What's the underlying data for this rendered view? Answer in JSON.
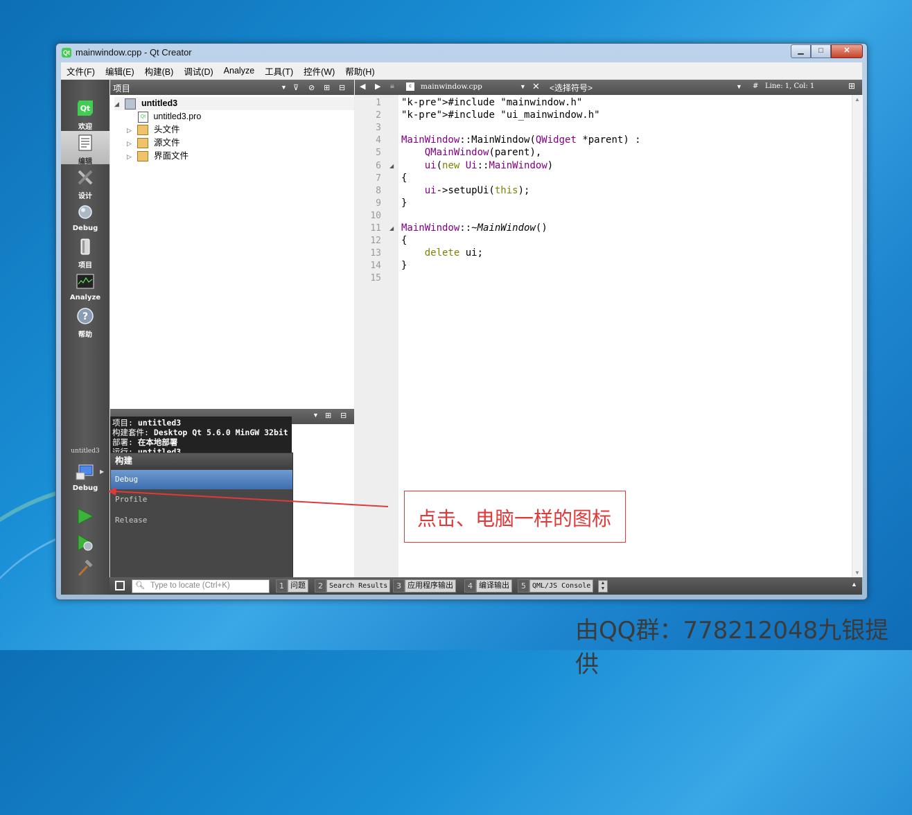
{
  "window": {
    "title": "mainwindow.cpp - Qt Creator",
    "controls": {
      "minimize": "▁",
      "maximize": "□",
      "close": "✕"
    }
  },
  "menu": [
    "文件(F)",
    "编辑(E)",
    "构建(B)",
    "调试(D)",
    "Analyze",
    "工具(T)",
    "控件(W)",
    "帮助(H)"
  ],
  "modes": [
    {
      "label": "欢迎",
      "icon": "qt-logo-icon"
    },
    {
      "label": "编辑",
      "icon": "document-icon",
      "active": true
    },
    {
      "label": "设计",
      "icon": "design-tools-icon"
    },
    {
      "label": "Debug",
      "icon": "bug-icon"
    },
    {
      "label": "项目",
      "icon": "project-icon"
    },
    {
      "label": "Analyze",
      "icon": "analyze-icon"
    },
    {
      "label": "帮助",
      "icon": "help-icon"
    }
  ],
  "kit_selector": {
    "project": "untitled3",
    "build": "Debug"
  },
  "project_panel": {
    "header": "项目",
    "tree": [
      {
        "label": "untitled3",
        "bold": true
      },
      {
        "label": "untitled3.pro"
      },
      {
        "label": "头文件"
      },
      {
        "label": "源文件"
      },
      {
        "label": "界面文件"
      }
    ]
  },
  "lower_panel": {
    "info": [
      {
        "key": "项目:",
        "value": "untitled3"
      },
      {
        "key": "构建套件:",
        "value": "Desktop Qt 5.6.0 MinGW 32bit"
      },
      {
        "key": "部署:",
        "value": "在本地部署"
      },
      {
        "key": "运行:",
        "value": "untitled3"
      }
    ]
  },
  "build_popup": {
    "header": "构建",
    "options": [
      "Debug",
      "Profile",
      "Release"
    ],
    "selected": "Debug"
  },
  "editor": {
    "file": "mainwindow.cpp",
    "symbol": "<选择符号>",
    "position": "Line: 1, Col: 1",
    "hash": "#"
  },
  "code_lines": [
    "#include \"mainwindow.h\"",
    "#include \"ui_mainwindow.h\"",
    "",
    "MainWindow::MainWindow(QWidget *parent) :",
    "    QMainWindow(parent),",
    "    ui(new Ui::MainWindow)",
    "{",
    "    ui->setupUi(this);",
    "}",
    "",
    "MainWindow::~MainWindow()",
    "{",
    "    delete ui;",
    "}",
    ""
  ],
  "status_bar": {
    "locator_placeholder": "Type to locate (Ctrl+K)",
    "tabs": [
      {
        "num": "1",
        "label": "问题"
      },
      {
        "num": "2",
        "label": "Search Results"
      },
      {
        "num": "3",
        "label": "应用程序输出"
      },
      {
        "num": "4",
        "label": "编译输出"
      },
      {
        "num": "5",
        "label": "QML/JS Console"
      }
    ]
  },
  "annotation": {
    "text": "点击、电脑一样的图标"
  },
  "watermark": "由QQ群：778212048九银提供"
}
